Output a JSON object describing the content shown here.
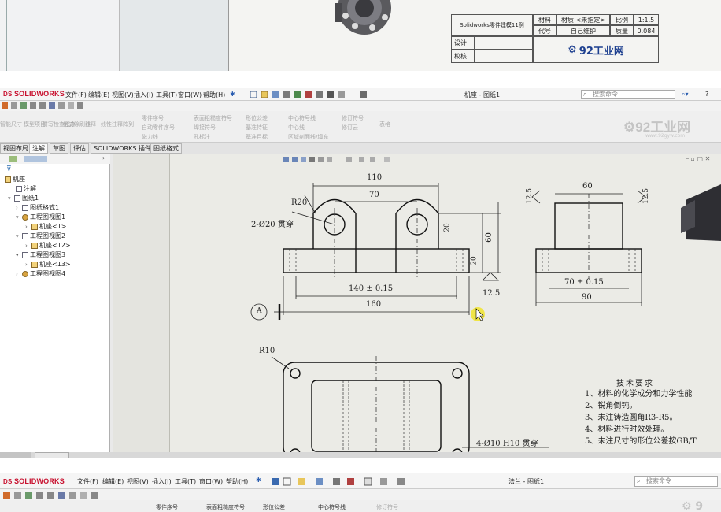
{
  "top_panel": {
    "title_block": {
      "part_name": "Solidworks零件建模11例",
      "material_label": "材料",
      "material_value": "材质 <未指定>",
      "scale_label": "比例",
      "scale_value": "1:1.5",
      "code_label": "代号",
      "code_value": "自己维护",
      "mass_label": "质量",
      "mass_value": "0.084",
      "design_label": "设计",
      "check_label": "校核",
      "brand": "92工业网"
    }
  },
  "window2": {
    "logo": "SOLIDWORKS",
    "menu": [
      "文件(F)",
      "编辑(E)",
      "视图(V)",
      "插入(I)",
      "工具(T)",
      "窗口(W)",
      "帮助(H)"
    ],
    "doc_title": "机座 - 图纸1",
    "search_placeholder": "搜索命令",
    "ribbon": {
      "left_buttons": [
        "智能尺寸",
        "模型项目",
        "拼写检查程序",
        "格式涂刷器",
        "注释",
        "线性注释阵列"
      ],
      "col1": [
        "零件序号",
        "自动零件序号",
        "磁力线"
      ],
      "col2": [
        "表面粗糙度符号",
        "焊接符号",
        "孔标注"
      ],
      "col3": [
        "形位公差",
        "基准特征",
        "基准目标"
      ],
      "col4": [
        "中心符号线",
        "中心线",
        "区域剖面线/填充"
      ],
      "col5": [
        "修订符号",
        "修订云"
      ],
      "table_label": "表格"
    },
    "tabs": [
      "视图布局",
      "注解",
      "草图",
      "评估",
      "SOLIDWORKS 插件",
      "图纸格式"
    ],
    "active_tab": "注解",
    "watermark": "92工业网",
    "watermark_url": "www.92gyw.com",
    "tree": {
      "root": "机座",
      "items": [
        "注解",
        "图纸1",
        "图纸格式1",
        "工程图视图1",
        "机座<1>",
        "工程图视图2",
        "机座<12>",
        "工程图视图3",
        "机座<13>",
        "工程图视图4"
      ]
    },
    "drawing": {
      "dims_front": [
        "110",
        "70",
        "R20",
        "2-Ø20 贯穿",
        "20",
        "60",
        "20",
        "140 ± 0.15",
        "160",
        "12.5",
        "A"
      ],
      "dims_side": [
        "60",
        "12.5",
        "12.5",
        "70 ± 0.15",
        "90"
      ],
      "dims_top": [
        "R10",
        "4-Ø10 H10 贯穿"
      ],
      "tech_title": "技术要求",
      "tech_notes": [
        "1、材料的化学成分和力学性能",
        "2、锐角倒钝。",
        "3、未注铸造圆角R3-R5。",
        "4、材料进行时效处理。",
        "5、未注尺寸的形位公差按GB/T"
      ]
    }
  },
  "window3": {
    "logo": "SOLIDWORKS",
    "menu": [
      "文件(F)",
      "编辑(E)",
      "视图(V)",
      "插入(I)",
      "工具(T)",
      "窗口(W)",
      "帮助(H)"
    ],
    "doc_title": "法兰 - 图纸1",
    "search_placeholder": "搜索命令",
    "ribbon": [
      "零件序号",
      "表面粗糙度符号",
      "形位公差",
      "中心符号线",
      "修订符号"
    ]
  }
}
